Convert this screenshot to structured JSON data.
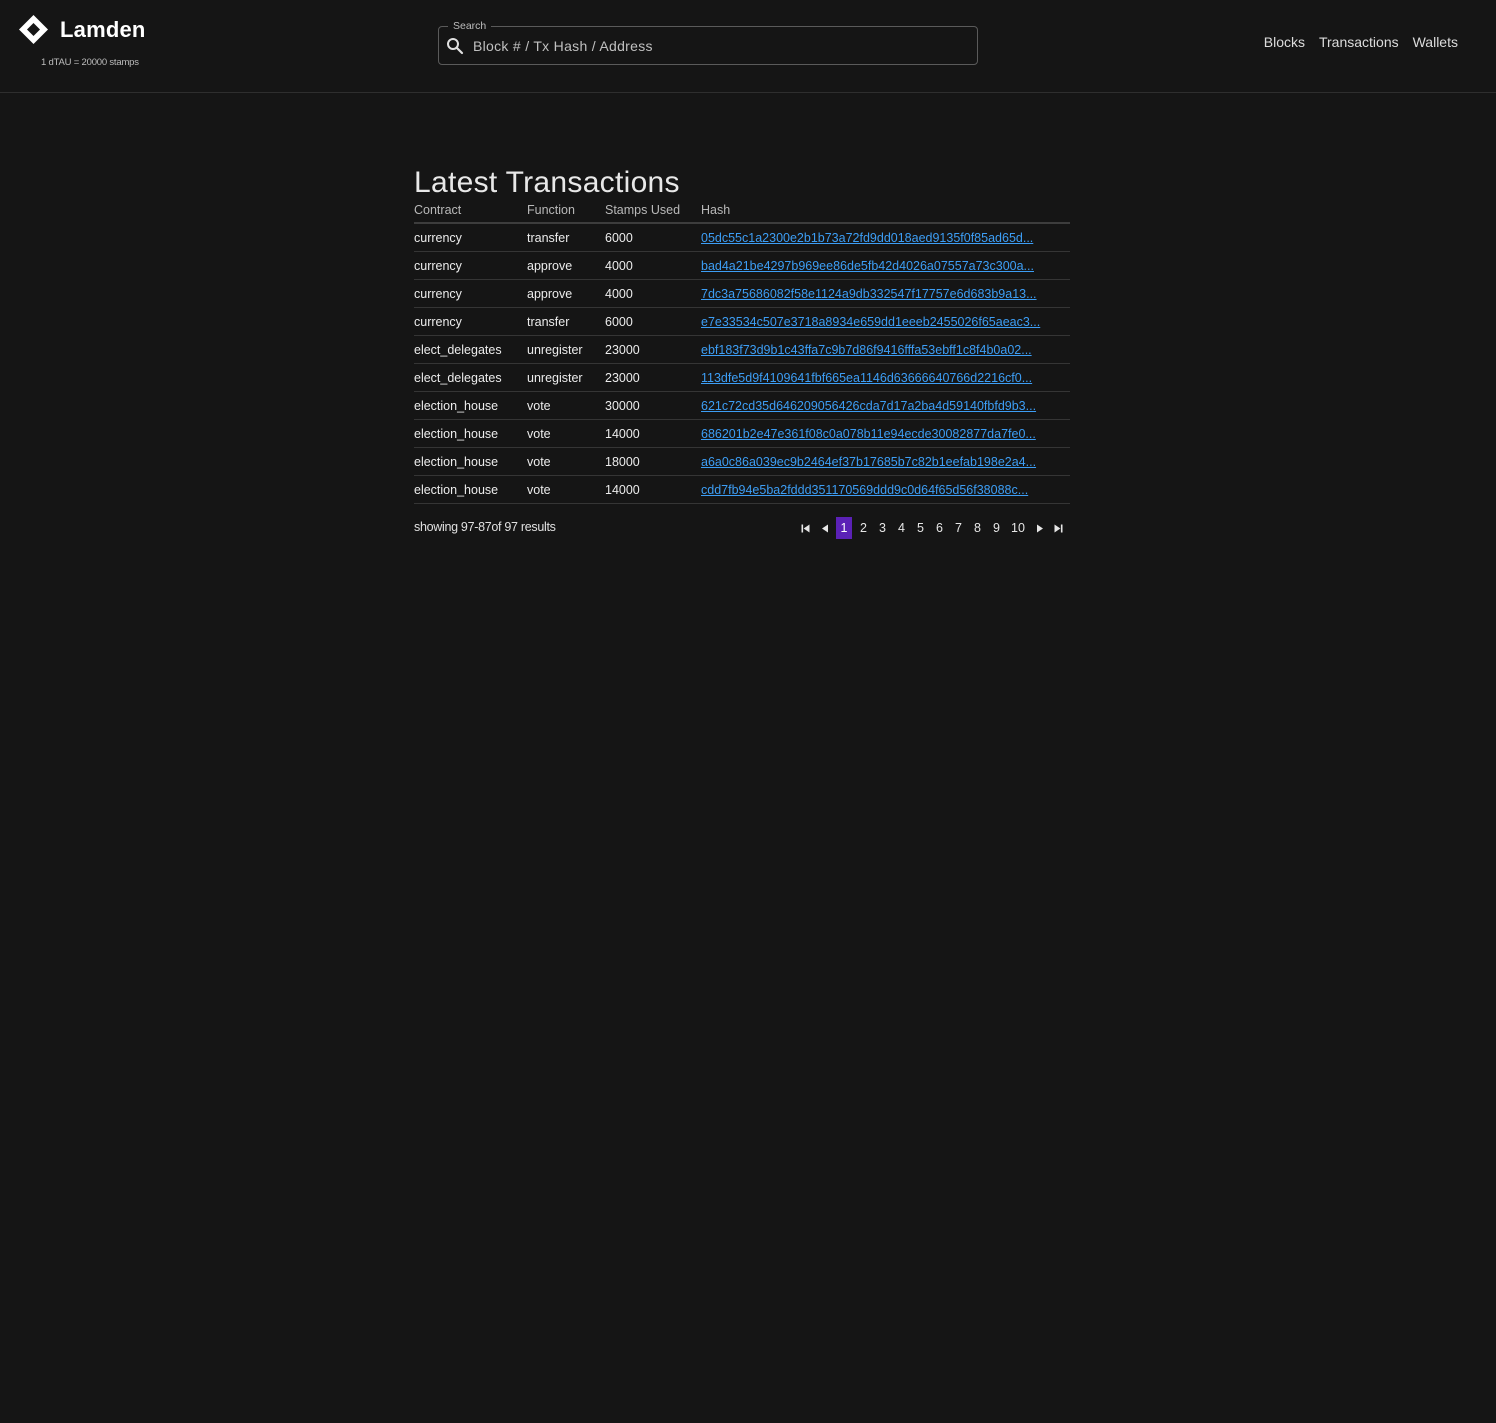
{
  "header": {
    "brand": "Lamden",
    "rate": "1 dTAU = 20000 stamps",
    "search": {
      "legend": "Search",
      "placeholder": "Block # / Tx Hash / Address"
    },
    "nav": {
      "blocks": "Blocks",
      "transactions": "Transactions",
      "wallets": "Wallets"
    }
  },
  "main": {
    "title": "Latest Transactions",
    "columns": {
      "contract": "Contract",
      "function": "Function",
      "stamps": "Stamps Used",
      "hash": "Hash"
    },
    "rows": [
      {
        "contract": "currency",
        "function": "transfer",
        "stamps": "6000",
        "hash": "05dc55c1a2300e2b1b73a72fd9dd018aed9135f0f85ad65d..."
      },
      {
        "contract": "currency",
        "function": "approve",
        "stamps": "4000",
        "hash": "bad4a21be4297b969ee86de5fb42d4026a07557a73c300a..."
      },
      {
        "contract": "currency",
        "function": "approve",
        "stamps": "4000",
        "hash": "7dc3a75686082f58e1124a9db332547f17757e6d683b9a13..."
      },
      {
        "contract": "currency",
        "function": "transfer",
        "stamps": "6000",
        "hash": "e7e33534c507e3718a8934e659dd1eeeb2455026f65aeac3..."
      },
      {
        "contract": "elect_delegates",
        "function": "unregister",
        "stamps": "23000",
        "hash": "ebf183f73d9b1c43ffa7c9b7d86f9416fffa53ebff1c8f4b0a02..."
      },
      {
        "contract": "elect_delegates",
        "function": "unregister",
        "stamps": "23000",
        "hash": "113dfe5d9f4109641fbf665ea1146d63666640766d2216cf0..."
      },
      {
        "contract": "election_house",
        "function": "vote",
        "stamps": "30000",
        "hash": "621c72cd35d646209056426cda7d17a2ba4d59140fbfd9b3..."
      },
      {
        "contract": "election_house",
        "function": "vote",
        "stamps": "14000",
        "hash": "686201b2e47e361f08c0a078b11e94ecde30082877da7fe0..."
      },
      {
        "contract": "election_house",
        "function": "vote",
        "stamps": "18000",
        "hash": "a6a0c86a039ec9b2464ef37b17685b7c82b1eefab198e2a4..."
      },
      {
        "contract": "election_house",
        "function": "vote",
        "stamps": "14000",
        "hash": "cdd7fb94e5ba2fddd351170569ddd9c0d64f65d56f38088c..."
      }
    ],
    "showing": "showing 97-87of 97 results",
    "pagination": {
      "active": "1",
      "pages": [
        "1",
        "2",
        "3",
        "4",
        "5",
        "6",
        "7",
        "8",
        "9",
        "10"
      ]
    }
  },
  "colors": {
    "background": "#151515",
    "link": "#3d9ef5",
    "active_page": "#5b21b6"
  },
  "icons": {
    "logo": "diamond-logo-icon",
    "search": "search-icon",
    "first": "first-page-icon",
    "prev": "prev-page-icon",
    "next": "next-page-icon",
    "last": "last-page-icon"
  }
}
